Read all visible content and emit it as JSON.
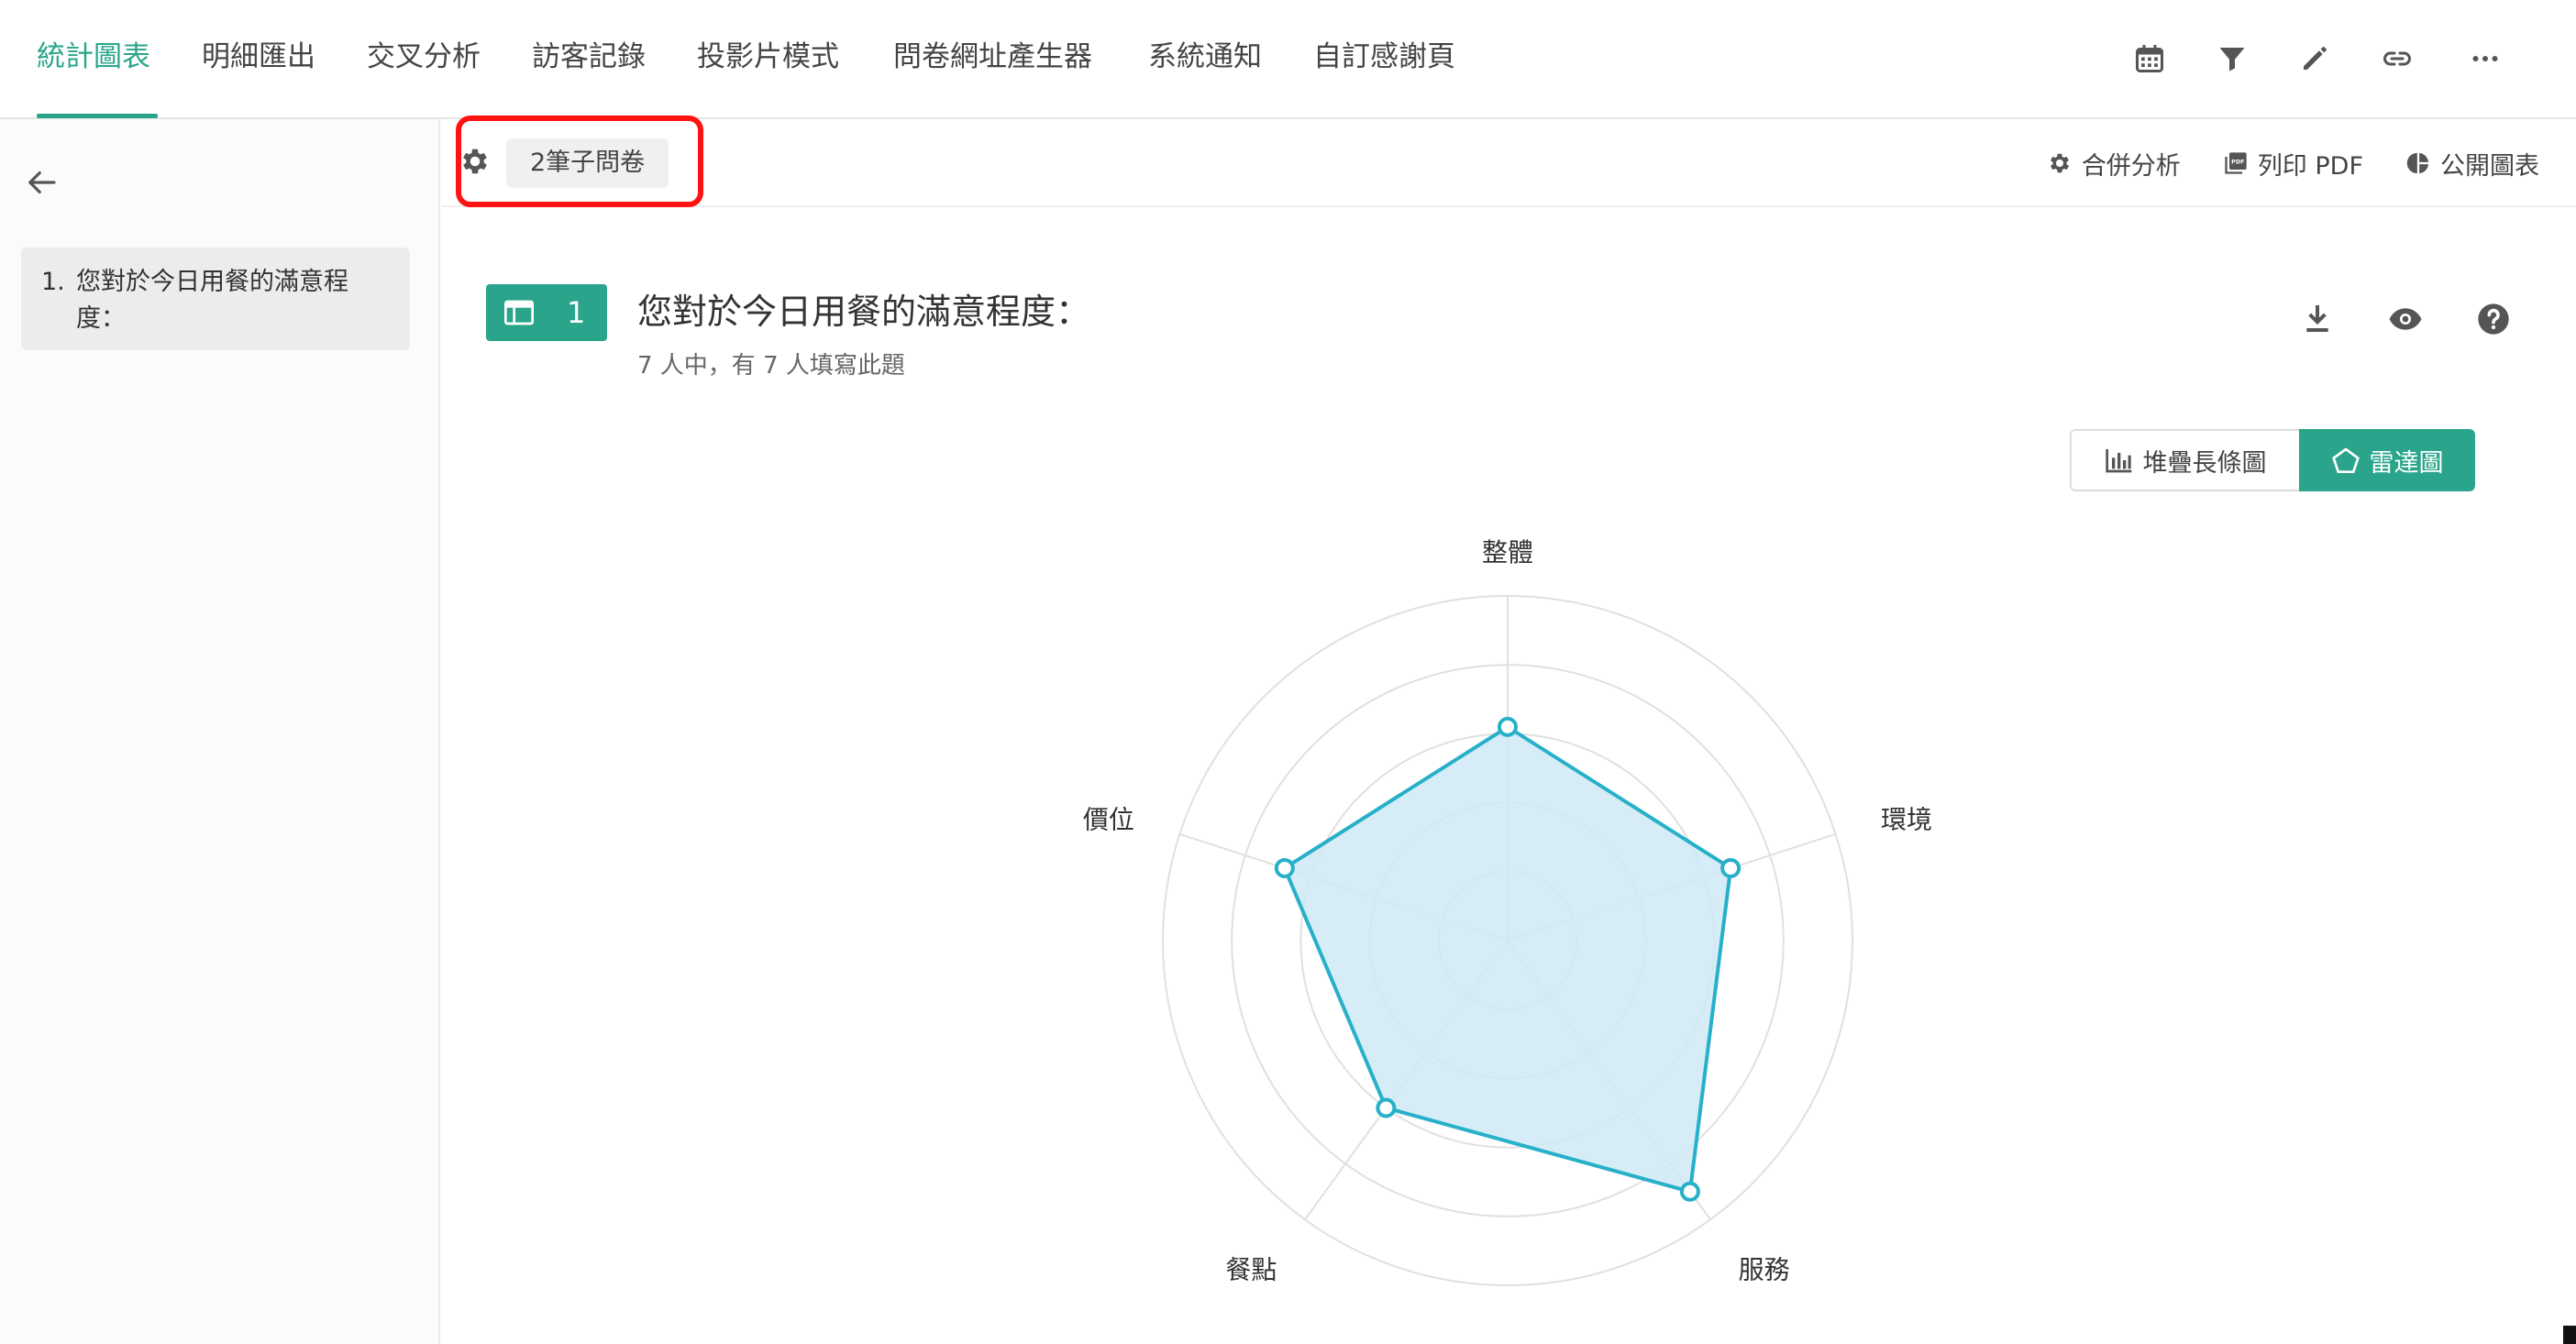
{
  "nav": {
    "tabs": [
      "統計圖表",
      "明細匯出",
      "交叉分析",
      "訪客記錄",
      "投影片模式",
      "問卷網址產生器",
      "系統通知",
      "自訂感謝頁"
    ],
    "active": 0,
    "icons": [
      "calendar-icon",
      "filter-icon",
      "pencil-icon",
      "link-icon",
      "more-icon"
    ]
  },
  "sidebar": {
    "items": [
      {
        "num": "1.",
        "label": "您對於今日用餐的滿意程度："
      }
    ]
  },
  "subbar": {
    "subquestion_label": "2筆子問卷",
    "merge_label": "合併分析",
    "print_label": "列印 PDF",
    "public_label": "公開圖表"
  },
  "question": {
    "number": "1",
    "title": "您對於今日用餐的滿意程度：",
    "summary": "7 人中，有 7 人填寫此題"
  },
  "chart_switch": {
    "stacked_label": "堆疊長條圖",
    "radar_label": "雷達圖",
    "selected": "radar"
  },
  "colors": {
    "accent": "#2aa58b",
    "radar_line": "#26b0c9",
    "radar_fill": "#cfe9f5",
    "highlight": "#ff1212"
  },
  "chart_data": {
    "type": "radar",
    "categories": [
      "整體",
      "環境",
      "服務",
      "餐點",
      "價位"
    ],
    "values": [
      3.1,
      3.4,
      4.5,
      3.0,
      3.4
    ],
    "range": [
      0,
      5
    ],
    "rings": 5,
    "grid": true
  }
}
